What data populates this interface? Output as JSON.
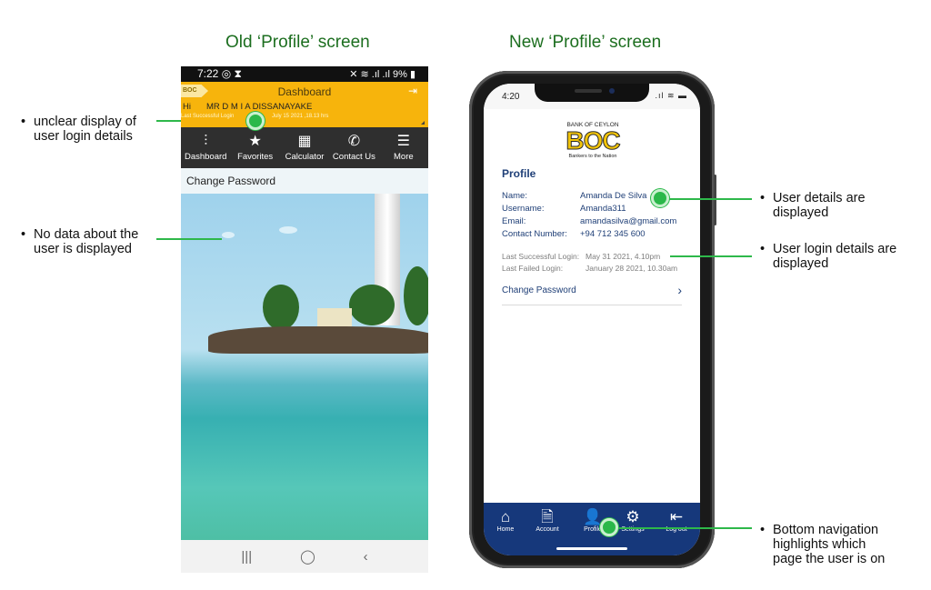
{
  "headings": {
    "old": "Old ‘Profile’ screen",
    "new": "New ‘Profile’ screen"
  },
  "annotations": {
    "left": [
      {
        "text_line1": "unclear display of",
        "text_line2": "user login details"
      },
      {
        "text_line1": "No data about the",
        "text_line2": "user is displayed"
      }
    ],
    "right": [
      {
        "text_line1": "User details are",
        "text_line2": "displayed"
      },
      {
        "text_line1": "User login details are",
        "text_line2": "displayed"
      },
      {
        "text_line1": "Bottom navigation",
        "text_line2": "highlights which",
        "text_line3": "page the user is on"
      }
    ],
    "bullet": "•",
    "accent_color": "#2eb84a"
  },
  "old_screen": {
    "status": {
      "time": "7:22",
      "time_icons": "◎ ⧗",
      "right": "✕ ≋ .ıl .ıl 9% ▮"
    },
    "header": {
      "logo_text": "BOC",
      "title": "Dashboard",
      "exit_icon": "⇥",
      "greeting": "Hi",
      "user_name": "MR D M I A DISSANAYAKE",
      "last_login_label": "Last Successful Login",
      "last_login_value": "July 15 2021 ,18.13 hrs"
    },
    "nav": [
      {
        "label": "Dashboard",
        "icon": "⫶"
      },
      {
        "label": "Favorites",
        "icon": "★"
      },
      {
        "label": "Calculator",
        "icon": "▦"
      },
      {
        "label": "Contact Us",
        "icon": "✆"
      },
      {
        "label": "More",
        "icon": "☰"
      }
    ],
    "change_password": "Change Password",
    "system_nav": {
      "recent": "|||",
      "home": "◯",
      "back": "‹"
    },
    "colors": {
      "header": "#f7b40c",
      "nav": "#2f2f2f"
    }
  },
  "new_screen": {
    "status": {
      "time": "4:20",
      "icons": ".ıl ≋ ▬"
    },
    "logo": {
      "top": "BANK OF CEYLON",
      "main": "BOC",
      "sub": "Bankers to the Nation"
    },
    "title": "Profile",
    "details": [
      {
        "label": "Name:",
        "value": "Amanda De Silva"
      },
      {
        "label": "Username:",
        "value": "Amanda311"
      },
      {
        "label": "Email:",
        "value": "amandasilva@gmail.com"
      },
      {
        "label": "Contact Number:",
        "value": "+94 712 345 600"
      }
    ],
    "logins": [
      {
        "label": "Last Successful Login:",
        "value": "May 31 2021, 4.10pm"
      },
      {
        "label": "Last Failed Login:",
        "value": "January 28 2021, 10.30am"
      }
    ],
    "change_password": "Change Password",
    "chevron": "›",
    "tabs": [
      {
        "label": "Home",
        "icon": "⌂"
      },
      {
        "label": "Account",
        "icon": "🗎"
      },
      {
        "label": "Profile",
        "icon": "👤",
        "active": true
      },
      {
        "label": "Settings",
        "icon": "⚙"
      },
      {
        "label": "Log out",
        "icon": "⇤"
      }
    ],
    "colors": {
      "primary": "#1f3f77",
      "tabbar": "#16387b",
      "active_icon": "#f7c948"
    }
  }
}
